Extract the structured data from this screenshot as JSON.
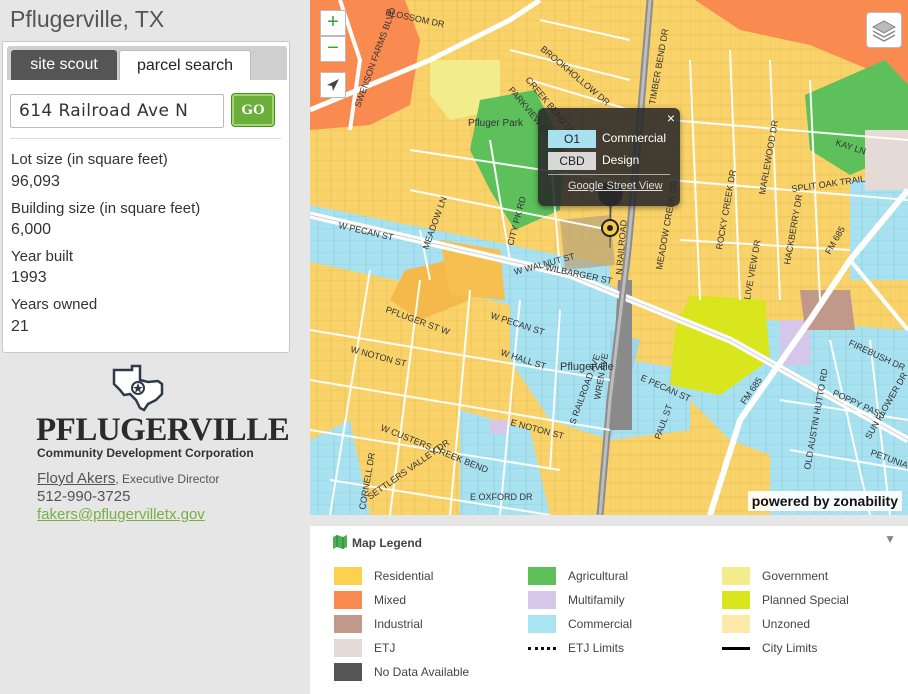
{
  "page": {
    "title": "Pflugerville, TX"
  },
  "tabs": [
    {
      "label": "site scout"
    },
    {
      "label": "parcel search"
    }
  ],
  "search": {
    "value": "614 Railroad Ave N",
    "go_label": "GO"
  },
  "parcel": [
    {
      "label": "Lot size (in square feet)",
      "value": "96,093"
    },
    {
      "label": "Building size (in square feet)",
      "value": "6,000"
    },
    {
      "label": "Year built",
      "value": "1993"
    },
    {
      "label": "Years owned",
      "value": "21"
    }
  ],
  "org": {
    "logo_text": "PFLUGERVILLE",
    "subtitle": "Community Development Corporation",
    "contact_name": "Floyd Akers",
    "contact_role": "Executive Director",
    "phone": "512-990-3725",
    "email": "fakers@pflugervilletx.gov"
  },
  "map": {
    "zoom_in": "+",
    "zoom_out": "−",
    "powered_by": "powered by zonability",
    "labels": {
      "pfluger_park": "Pfluger Park",
      "pflugerville": "Pflugerville",
      "w_pecan_st": "W PECAN ST",
      "e_pecan_st": "E PECAN ST",
      "w_pecan_st2": "W PECAN ST",
      "fm685": "FM 685",
      "railroad_ave": "S RAILROAD AVE",
      "w_noton_st": "W NOTON ST",
      "e_noton_st": "E NOTON ST",
      "w_hall_st": "W HALL ST",
      "timber_bend": "TIMBER BEND DR",
      "rocky_creek": "ROCKY CREEK DR",
      "meadow_creek": "MEADOW CREEK DR",
      "hackberry": "HACKBERRY DR",
      "kay_ln": "KAY LN",
      "split_oak": "SPLIT OAK TRAIL",
      "w_walnut": "W WALNUT ST",
      "wilbarger": "WILBARGER ST",
      "city_pk": "CITY PK RD",
      "meadow_ln": "MEADOW LN",
      "blossom": "BLOSSOM DR",
      "paul_st": "PAUL ST",
      "firebush": "FIREBUSH DR",
      "old_austin": "OLD AUSTIN HUTTO RD",
      "poppy": "POPPY PASS",
      "sun_flower": "SUN FLOWER DR",
      "petunia": "PETUNIA LN",
      "settlers": "SETTLERS VALLEY DR",
      "w_custers": "W CUSTERS CREEK BEND",
      "e_oxford": "E OXFORD DR",
      "cornell": "CORNELL DR",
      "pfluger_st": "PFLUGER ST W",
      "wrenn": "WREN AVE",
      "railroad_n": "N RAILROAD",
      "creek_bend": "CREEK BEND DR",
      "parkview": "PARKVIEW DR",
      "brookhollow": "BROOKHOLLOW DR",
      "marlewood": "MARLEWOOD DR",
      "live_oak": "LIVE VIEW DR",
      "swenson": "SWENSON FARMS BLVD"
    },
    "popup": {
      "zones": [
        {
          "code": "O1",
          "name": "Commercial",
          "color": "#a8e1f0"
        },
        {
          "code": "CBD",
          "name": "Design",
          "color": "#d8d8d8"
        }
      ],
      "link": "Google Street View",
      "close": "×"
    }
  },
  "legend": {
    "title": "Map Legend",
    "items": [
      {
        "label": "Residential",
        "color": "#fcd14f",
        "kind": "swatch"
      },
      {
        "label": "Agricultural",
        "color": "#5dc05a",
        "kind": "swatch"
      },
      {
        "label": "Government",
        "color": "#f2ec8c",
        "kind": "swatch"
      },
      {
        "label": "Mixed",
        "color": "#f98b50",
        "kind": "swatch"
      },
      {
        "label": "Multifamily",
        "color": "#d6c7ea",
        "kind": "swatch"
      },
      {
        "label": "Planned Special",
        "color": "#d9e61d",
        "kind": "swatch"
      },
      {
        "label": "Industrial",
        "color": "#c0998a",
        "kind": "swatch"
      },
      {
        "label": "Commercial",
        "color": "#a8e4f2",
        "kind": "swatch"
      },
      {
        "label": "Unzoned",
        "color": "#fde9a8",
        "kind": "swatch"
      },
      {
        "label": "ETJ",
        "color": "#e6dad6",
        "kind": "swatch"
      },
      {
        "label": "ETJ Limits",
        "color": "#111111",
        "kind": "dotted"
      },
      {
        "label": "City Limits",
        "color": "#000000",
        "kind": "line"
      },
      {
        "label": "No Data Available",
        "color": "#555555",
        "kind": "swatch"
      }
    ]
  }
}
